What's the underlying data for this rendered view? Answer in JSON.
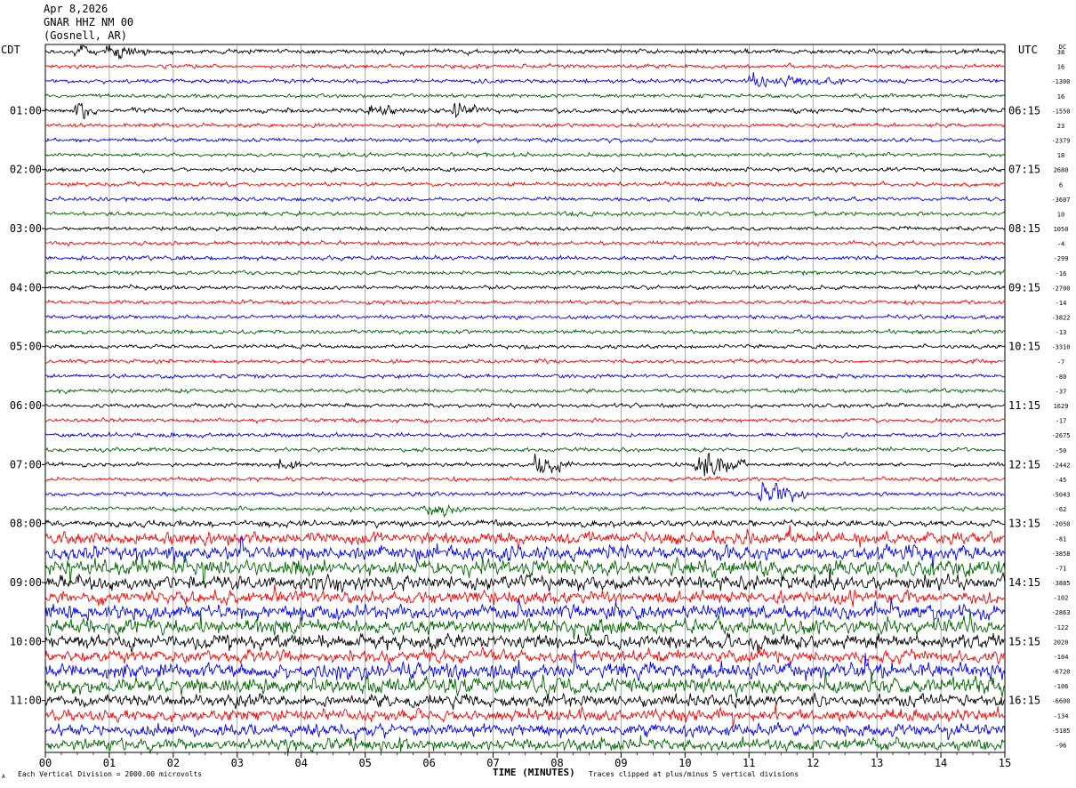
{
  "header": {
    "date": "Apr 8,2026",
    "station": "GNAR HHZ NM 00",
    "location": "(Gosnell, AR)"
  },
  "left_timezone": "CDT",
  "right_timezone": "UTC",
  "dc_header": "DC",
  "footer": {
    "scale_note": "Each Vertical Division = 2000.00 microvolts",
    "clip_note": "Traces clipped at plus/minus 5 vertical divisions",
    "corner_mark": "A"
  },
  "chart_data": {
    "type": "line",
    "xlabel": "TIME (MINUTES)",
    "xlim": [
      0,
      15
    ],
    "x_ticks": [
      "00",
      "01",
      "02",
      "03",
      "04",
      "05",
      "06",
      "07",
      "08",
      "09",
      "10",
      "11",
      "12",
      "13",
      "14",
      "15"
    ],
    "left_hour_labels": [
      "01:00",
      "02:00",
      "03:00",
      "04:00",
      "05:00",
      "06:00",
      "07:00",
      "08:00",
      "09:00",
      "10:00",
      "11:00"
    ],
    "right_hour_labels": [
      "06:15",
      "07:15",
      "08:15",
      "09:15",
      "10:15",
      "11:15",
      "12:15",
      "13:15",
      "14:15",
      "15:15",
      "16:15"
    ],
    "trace_colors": [
      "#000000",
      "#ff0000",
      "#0000ff",
      "#006400"
    ],
    "trace_count": 48,
    "dc_offsets": [
      "38",
      "16",
      "-1300",
      "16",
      "-1550",
      "23",
      "-2379",
      "18",
      "2680",
      "6",
      "-3607",
      "10",
      "1050",
      "-4",
      "-299",
      "-16",
      "-2700",
      "-14",
      "-3822",
      "-13",
      "-3310",
      "-7",
      "-80",
      "-37",
      "1629",
      "-17",
      "-2675",
      "-50",
      "-2442",
      "-45",
      "-5043",
      "-62",
      "-2050",
      "-81",
      "-3858",
      "-71",
      "-3885",
      "-102",
      "-2863",
      "-122",
      "2020",
      "-104",
      "-6720",
      "-106",
      "-6600",
      "-134",
      "-5185",
      "-96"
    ],
    "noise_amplitude_by_trace": [
      1.2,
      1,
      1,
      1,
      1.2,
      1,
      1,
      1,
      1,
      1,
      1,
      1,
      1,
      1,
      1,
      1,
      1,
      1,
      1,
      1,
      1,
      1,
      1,
      1,
      1,
      1,
      1,
      1,
      1,
      1,
      1,
      1,
      1.6,
      3,
      3.5,
      4,
      3.5,
      3.2,
      3.8,
      3.8,
      3.5,
      3,
      4,
      4,
      3,
      3,
      3,
      3
    ],
    "events": [
      {
        "trace": 0,
        "minute": 0.5,
        "duration": 0.3,
        "amplitude": 7
      },
      {
        "trace": 0,
        "minute": 1.0,
        "duration": 0.6,
        "amplitude": 8
      },
      {
        "trace": 4,
        "minute": 0.5,
        "duration": 0.3,
        "amplitude": 7
      },
      {
        "trace": 4,
        "minute": 5.1,
        "duration": 0.4,
        "amplitude": 7
      },
      {
        "trace": 4,
        "minute": 6.4,
        "duration": 0.4,
        "amplitude": 8
      },
      {
        "trace": 2,
        "minute": 11.0,
        "duration": 1.5,
        "amplitude": 5
      },
      {
        "trace": 28,
        "minute": 3.7,
        "duration": 0.4,
        "amplitude": 6
      },
      {
        "trace": 28,
        "minute": 7.7,
        "duration": 0.5,
        "amplitude": 9
      },
      {
        "trace": 28,
        "minute": 10.2,
        "duration": 0.8,
        "amplitude": 14
      },
      {
        "trace": 30,
        "minute": 11.2,
        "duration": 0.7,
        "amplitude": 12
      },
      {
        "trace": 31,
        "minute": 6.0,
        "duration": 0.6,
        "amplitude": 6
      }
    ]
  }
}
